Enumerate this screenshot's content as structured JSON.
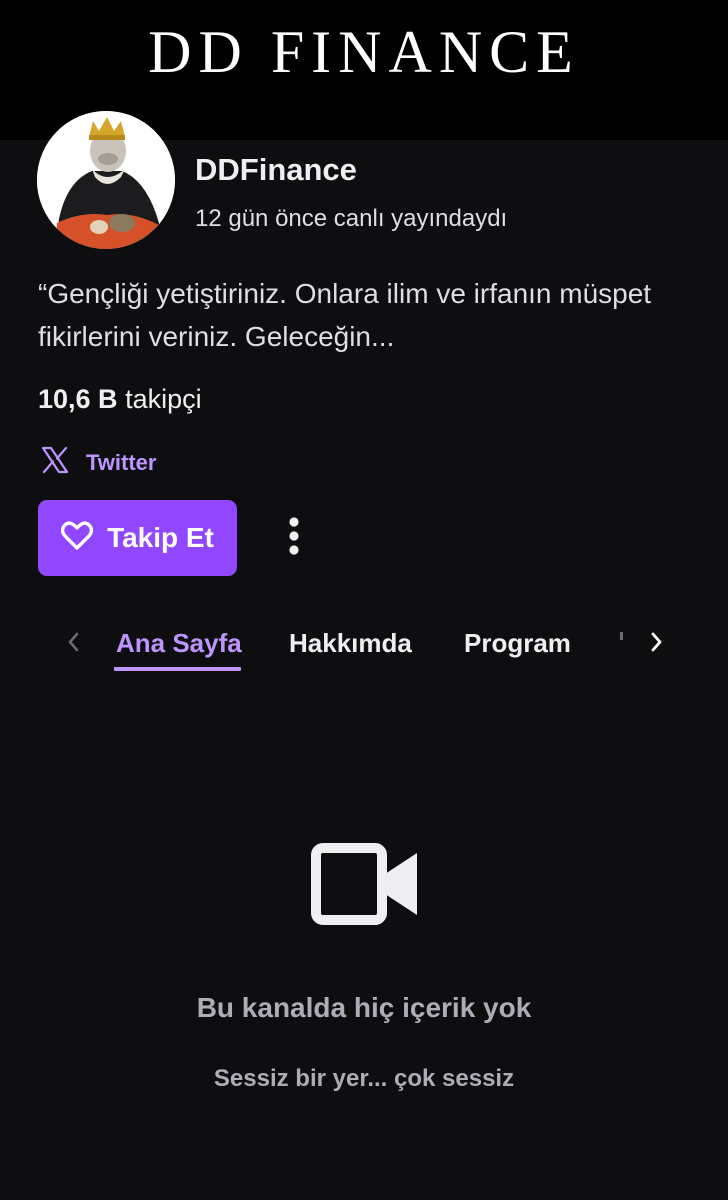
{
  "banner": {
    "title": "DD FINANCE"
  },
  "channel": {
    "name": "DDFinance",
    "last_live": "12 gün önce canlı yayındaydı",
    "bio": "“Gençliği yetiştiriniz. Onlara ilim ve irfanın müspet fikirlerini veriniz. Geleceğin...",
    "followers_count": "10,6 B",
    "followers_label": "takipçi"
  },
  "social": {
    "icon": "x-logo-icon",
    "label": "Twitter"
  },
  "actions": {
    "follow_label": "Takip Et",
    "follow_icon": "heart-icon",
    "more_icon": "vertical-ellipsis-icon"
  },
  "tabs": {
    "items": [
      {
        "label": "Ana Sayfa",
        "active": true
      },
      {
        "label": "Hakkımda",
        "active": false
      },
      {
        "label": "Program",
        "active": false
      }
    ]
  },
  "empty_state": {
    "icon": "video-camera-icon",
    "title": "Bu kanalda hiç içerik yok",
    "subtitle": "Sessiz bir yer... çok sessiz"
  },
  "colors": {
    "background": "#0e0e10",
    "accent": "#9147ff",
    "accent_text": "#bf94ff",
    "muted_text": "#adadb8"
  }
}
